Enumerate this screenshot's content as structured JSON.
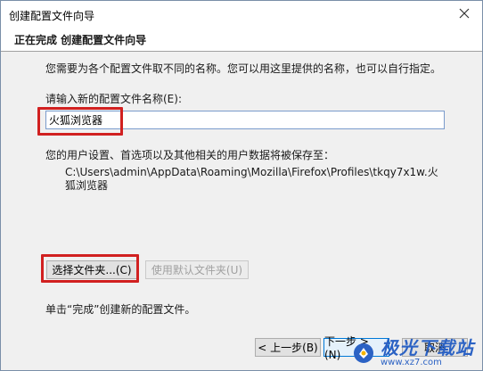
{
  "window": {
    "title": "创建配置文件向导",
    "header": "正在完成 创建配置文件向导"
  },
  "content": {
    "description": "您需要为各个配置文件取不同的名称。您可以用这里提供的名称，也可以自行指定。",
    "input_label": "请输入新的配置文件名称(E):",
    "input_value": "火狐浏览器",
    "save_location_label": "您的用户设置、首选项以及其他相关的用户数据将被保存至：",
    "save_path": "C:\\Users\\admin\\AppData\\Roaming\\Mozilla\\Firefox\\Profiles\\tkqy7x1w.火狐浏览器",
    "choose_folder_label": "选择文件夹...(C)",
    "use_default_label": "使用默认文件夹(U)",
    "finish_hint": "单击“完成”创建新的配置文件。"
  },
  "buttons": {
    "back": "< 上一步(B)",
    "next": "下一步 > (N)",
    "cancel": "取消"
  },
  "icons": {
    "close": "close-icon",
    "watermark_logo": "watermark-logo-icon"
  },
  "colors": {
    "highlight": "#d12020",
    "panel_bg": "#f0f0f0",
    "watermark": "#2b62c4"
  },
  "watermark": {
    "title": "极光下载站",
    "url": "www.xz7.com"
  }
}
